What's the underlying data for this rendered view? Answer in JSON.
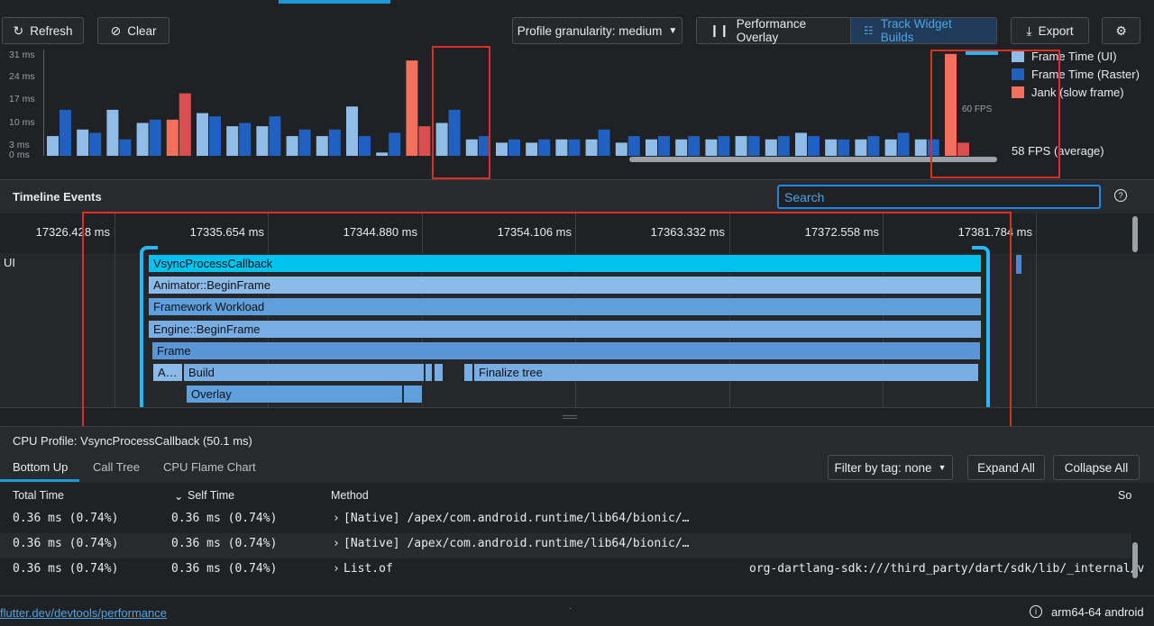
{
  "toolbar": {
    "refresh_label": "Refresh",
    "clear_label": "Clear",
    "granularity_label": "Profile granularity: medium",
    "performance_overlay_label": "Performance Overlay",
    "track_widget_builds_label": "Track Widget Builds",
    "export_label": "Export"
  },
  "frame_chart": {
    "y_ticks": [
      "31 ms",
      "24 ms",
      "17 ms",
      "10 ms",
      "3 ms",
      "0 ms"
    ],
    "fps_overlay": "60 FPS",
    "legend": {
      "ui": "Frame Time (UI)",
      "raster": "Frame Time (Raster)",
      "jank": "Jank (slow frame)",
      "average": "58 FPS (average)"
    },
    "colors": {
      "ui": "#90bde8",
      "raster": "#2060c0",
      "jank": "#f2705c",
      "jank_raster": "#d94f4f"
    },
    "frames_ms": [
      [
        6,
        14
      ],
      [
        8,
        7
      ],
      [
        14,
        5
      ],
      [
        10,
        11
      ],
      [
        11,
        19
      ],
      [
        13,
        12
      ],
      [
        9,
        10
      ],
      [
        9,
        12
      ],
      [
        6,
        8
      ],
      [
        6,
        8
      ],
      [
        15,
        6
      ],
      [
        1,
        7
      ],
      [
        29,
        9
      ],
      [
        10,
        14
      ],
      [
        5,
        6
      ],
      [
        4,
        5
      ],
      [
        4,
        5
      ],
      [
        5,
        5
      ],
      [
        5,
        8
      ],
      [
        4,
        6
      ],
      [
        5,
        6
      ],
      [
        5,
        6
      ],
      [
        5,
        6
      ],
      [
        6,
        6
      ],
      [
        5,
        6
      ],
      [
        7,
        6
      ],
      [
        5,
        5
      ],
      [
        5,
        6
      ],
      [
        5,
        7
      ],
      [
        5,
        5
      ],
      [
        31,
        4
      ]
    ],
    "jank_flags": [
      false,
      false,
      false,
      false,
      true,
      false,
      false,
      false,
      false,
      false,
      false,
      false,
      true,
      false,
      false,
      false,
      false,
      false,
      false,
      false,
      false,
      false,
      false,
      false,
      false,
      false,
      false,
      false,
      false,
      false,
      true
    ]
  },
  "timeline": {
    "title": "Timeline Events",
    "search_placeholder": "Search",
    "ticks": [
      "17326.428 ms",
      "17335.654 ms",
      "17344.880 ms",
      "17354.106 ms",
      "17363.332 ms",
      "17372.558 ms",
      "17381.784 ms"
    ],
    "lane_label": "UI",
    "events": {
      "vsync": "VsyncProcessCallback",
      "animator": "Animator::BeginFrame",
      "framework": "Framework Workload",
      "engine": "Engine::BeginFrame",
      "frame": "Frame",
      "animate": "A…",
      "build": "Build",
      "finalize": "Finalize tree",
      "overlay": "Overlay"
    }
  },
  "cpu_profile": {
    "title": "CPU Profile: VsyncProcessCallback (50.1 ms)",
    "tabs": [
      "Bottom Up",
      "Call Tree",
      "CPU Flame Chart"
    ],
    "filter_label": "Filter by tag: none",
    "expand_all": "Expand All",
    "collapse_all": "Collapse All",
    "columns": {
      "total": "Total Time",
      "self": "Self Time",
      "method": "Method",
      "source": "So"
    },
    "rows": [
      {
        "total": "0.36 ms (0.74%)",
        "self": "0.36 ms (0.74%)",
        "method": "[Native] /apex/com.android.runtime/lib64/bionic/…",
        "source": ""
      },
      {
        "total": "0.36 ms (0.74%)",
        "self": "0.36 ms (0.74%)",
        "method": "[Native] /apex/com.android.runtime/lib64/bionic/…",
        "source": ""
      },
      {
        "total": "0.36 ms (0.74%)",
        "self": "0.36 ms (0.74%)",
        "method": "List.of",
        "source": "org-dartlang-sdk:///third_party/dart/sdk/lib/_internal/v"
      }
    ]
  },
  "footer": {
    "link": "flutter.dev/devtools/performance",
    "device": "arm64-64 android"
  }
}
